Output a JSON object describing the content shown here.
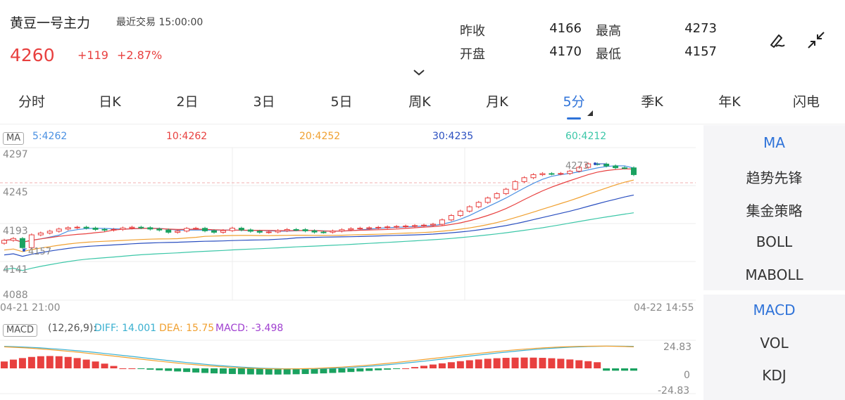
{
  "header": {
    "title": "黄豆一号主力",
    "last_trade_label": "最近交易",
    "last_trade_time": "15:00:00",
    "price": "4260",
    "change": "+119",
    "change_pct": "+2.87%"
  },
  "stats": [
    {
      "label": "昨收",
      "value": "4166"
    },
    {
      "label": "最高",
      "value": "4273"
    },
    {
      "label": "开盘",
      "value": "4170"
    },
    {
      "label": "最低",
      "value": "4157"
    }
  ],
  "tabs": [
    "分时",
    "日K",
    "2日",
    "3日",
    "5日",
    "周K",
    "月K",
    "5分",
    "季K",
    "年K",
    "闪电"
  ],
  "active_tab": "5分",
  "ma_bar": {
    "badge": "MA",
    "items": [
      {
        "text": "5:4262",
        "color": "#4a90e2"
      },
      {
        "text": "10:4262",
        "color": "#e8403f"
      },
      {
        "text": "20:4252",
        "color": "#f0a030"
      },
      {
        "text": "30:4235",
        "color": "#2a4fc0"
      },
      {
        "text": "60:4212",
        "color": "#3cc7a8"
      }
    ]
  },
  "price_axis": [
    "4297",
    "4245",
    "4193",
    "4141",
    "4088"
  ],
  "annotations": {
    "high": "4273",
    "low": "4157"
  },
  "time_axis": {
    "start": "04-21 21:00",
    "end": "04-22 14:55"
  },
  "macd_bar": {
    "badge": "MACD",
    "params": "(12,26,9):",
    "diff": "DIFF: 14.001",
    "dea": "DEA: 15.75",
    "macd": "MACD: -3.498",
    "diff_color": "#3ab0d0",
    "dea_color": "#f0a030",
    "macd_color": "#a040d0"
  },
  "macd_axis": {
    "top": "24.83",
    "mid": "0",
    "bottom": "-24.83"
  },
  "sidebar": {
    "main": [
      "MA",
      "趋势先锋",
      "集金策略",
      "BOLL",
      "MABOLL"
    ],
    "sub": [
      "MACD",
      "VOL",
      "KDJ"
    ]
  },
  "colors": {
    "up": "#e8403f",
    "down": "#1aa260",
    "accent": "#2f73d9"
  }
}
